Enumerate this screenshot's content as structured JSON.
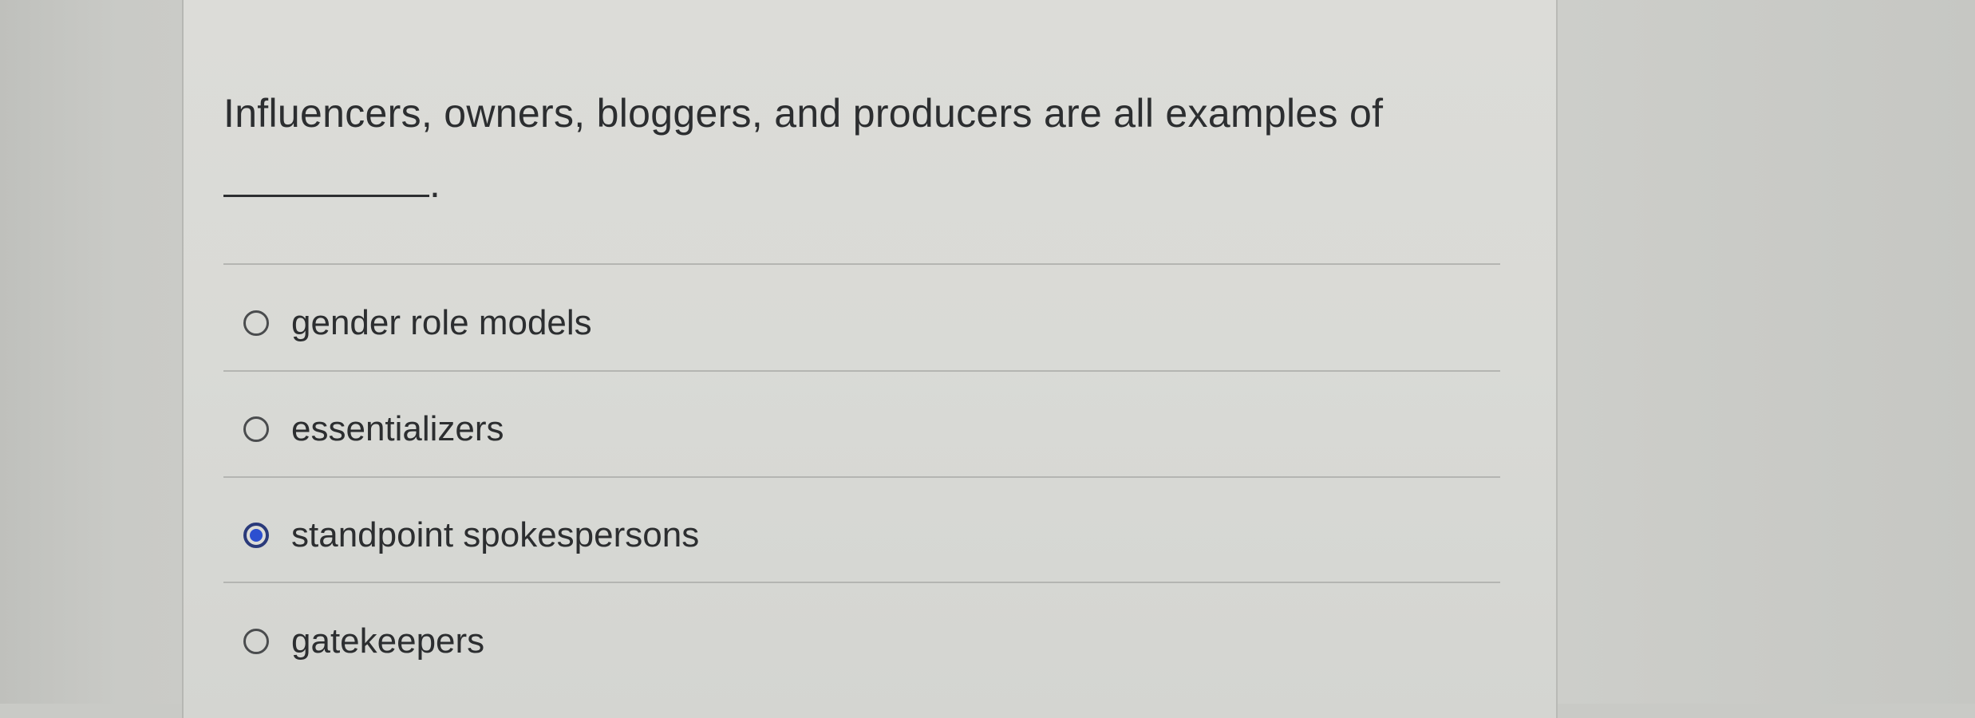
{
  "question": {
    "text": "Influencers, owners, bloggers, and producers are all examples of",
    "suffix": "."
  },
  "options": [
    {
      "label": "gender role models",
      "selected": false
    },
    {
      "label": "essentializers",
      "selected": false
    },
    {
      "label": "standpoint spokespersons",
      "selected": true
    },
    {
      "label": "gatekeepers",
      "selected": false
    }
  ],
  "colors": {
    "text": "#2c2e30",
    "selected_radio": "#2c4fd0",
    "card_background": "#dcdcd8"
  }
}
